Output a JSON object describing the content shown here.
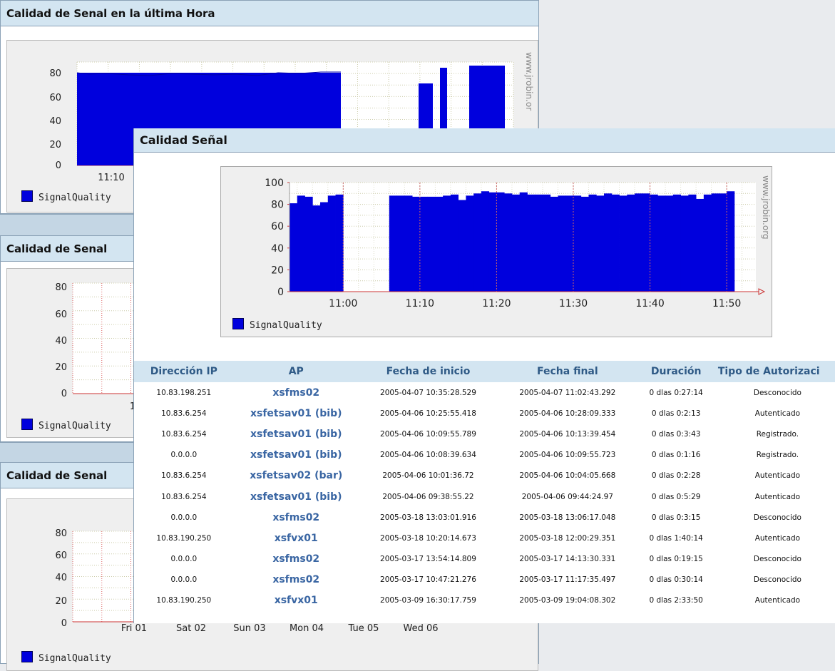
{
  "background_panels": {
    "hour": {
      "title": "Calidad de Senal en la última Hora",
      "y_ticks": [
        "80",
        "60",
        "40",
        "20",
        "0"
      ],
      "x_label": "11:10",
      "watermark": "www.jrobin.or",
      "legend": "SignalQuality"
    },
    "second": {
      "title": "Calidad de Senal",
      "y_ticks": [
        "80",
        "60",
        "40",
        "20",
        "0"
      ],
      "x_label_partial": "1",
      "legend": "SignalQuality"
    },
    "third": {
      "title": "Calidad de Senal",
      "y_ticks": [
        "80",
        "60",
        "40",
        "20",
        "0"
      ],
      "x_labels": [
        "Fri 01",
        "Sat 02",
        "Sun 03",
        "Mon 04",
        "Tue 05",
        "Wed 06"
      ],
      "legend": "SignalQuality"
    }
  },
  "front_window": {
    "title": "Calidad Señal",
    "legend": "SignalQuality",
    "watermark": "www.jrobin.org"
  },
  "chart_data": [
    {
      "type": "area",
      "title": "",
      "x": [
        "11:00",
        "11:10",
        "11:20",
        "11:30",
        "11:40",
        "11:50"
      ],
      "ylim": [
        0,
        100
      ],
      "y_ticks": [
        0,
        20,
        40,
        60,
        80,
        100
      ],
      "grid": true,
      "legend_position": "bottom-left",
      "series": [
        {
          "name": "SignalQuality",
          "color": "#0000dd",
          "points": [
            [
              "10:54",
              81
            ],
            [
              "10:55",
              88
            ],
            [
              "10:56",
              87
            ],
            [
              "10:57",
              79
            ],
            [
              "10:58",
              82
            ],
            [
              "10:59",
              88
            ],
            [
              "11:00",
              89
            ],
            [
              "11:07",
              88
            ],
            [
              "11:08",
              88
            ],
            [
              "11:09",
              88
            ],
            [
              "11:10",
              87
            ],
            [
              "11:11",
              87
            ],
            [
              "11:12",
              87
            ],
            [
              "11:13",
              87
            ],
            [
              "11:14",
              88
            ],
            [
              "11:15",
              89
            ],
            [
              "11:16",
              84
            ],
            [
              "11:17",
              88
            ],
            [
              "11:18",
              90
            ],
            [
              "11:19",
              92
            ],
            [
              "11:20",
              91
            ],
            [
              "11:21",
              91
            ],
            [
              "11:22",
              90
            ],
            [
              "11:23",
              89
            ],
            [
              "11:24",
              91
            ],
            [
              "11:25",
              89
            ],
            [
              "11:26",
              89
            ],
            [
              "11:27",
              89
            ],
            [
              "11:28",
              87
            ],
            [
              "11:29",
              88
            ],
            [
              "11:30",
              88
            ],
            [
              "11:31",
              88
            ],
            [
              "11:32",
              87
            ],
            [
              "11:33",
              89
            ],
            [
              "11:34",
              88
            ],
            [
              "11:35",
              90
            ],
            [
              "11:36",
              89
            ],
            [
              "11:37",
              88
            ],
            [
              "11:38",
              89
            ],
            [
              "11:39",
              90
            ],
            [
              "11:40",
              90
            ],
            [
              "11:41",
              89
            ],
            [
              "11:42",
              88
            ],
            [
              "11:43",
              88
            ],
            [
              "11:44",
              89
            ],
            [
              "11:45",
              88
            ],
            [
              "11:46",
              89
            ],
            [
              "11:47",
              85
            ],
            [
              "11:48",
              89
            ],
            [
              "11:49",
              90
            ],
            [
              "11:50",
              90
            ],
            [
              "11:51",
              92
            ]
          ]
        }
      ]
    }
  ],
  "table": {
    "headers": [
      "Dirección IP",
      "AP",
      "Fecha de inicio",
      "Fecha final",
      "Duración",
      "Tipo de Autorizaci"
    ],
    "rows": [
      [
        "10.83.198.251",
        "xsfms02",
        "2005-04-07 10:35:28.529",
        "2005-04-07 11:02:43.292",
        "0 dlas 0:27:14",
        "Desconocido"
      ],
      [
        "10.83.6.254",
        "xsfetsav01 (bib)",
        "2005-04-06 10:25:55.418",
        "2005-04-06 10:28:09.333",
        "0 dlas 0:2:13",
        "Autenticado"
      ],
      [
        "10.83.6.254",
        "xsfetsav01 (bib)",
        "2005-04-06 10:09:55.789",
        "2005-04-06 10:13:39.454",
        "0 dlas 0:3:43",
        "Registrado."
      ],
      [
        "0.0.0.0",
        "xsfetsav01 (bib)",
        "2005-04-06 10:08:39.634",
        "2005-04-06 10:09:55.723",
        "0 dlas 0:1:16",
        "Registrado."
      ],
      [
        "10.83.6.254",
        "xsfetsav02 (bar)",
        "2005-04-06 10:01:36.72",
        "2005-04-06 10:04:05.668",
        "0 dlas 0:2:28",
        "Autenticado"
      ],
      [
        "10.83.6.254",
        "xsfetsav01 (bib)",
        "2005-04-06 09:38:55.22",
        "2005-04-06 09:44:24.97",
        "0 dlas 0:5:29",
        "Autenticado"
      ],
      [
        "0.0.0.0",
        "xsfms02",
        "2005-03-18 13:03:01.916",
        "2005-03-18 13:06:17.048",
        "0 dlas 0:3:15",
        "Desconocido"
      ],
      [
        "10.83.190.250",
        "xsfvx01",
        "2005-03-18 10:20:14.673",
        "2005-03-18 12:00:29.351",
        "0 dlas 1:40:14",
        "Autenticado"
      ],
      [
        "0.0.0.0",
        "xsfms02",
        "2005-03-17 13:54:14.809",
        "2005-03-17 14:13:30.331",
        "0 dlas 0:19:15",
        "Desconocido"
      ],
      [
        "0.0.0.0",
        "xsfms02",
        "2005-03-17 10:47:21.276",
        "2005-03-17 11:17:35.497",
        "0 dlas 0:30:14",
        "Desconocido"
      ],
      [
        "10.83.190.250",
        "xsfvx01",
        "2005-03-09 16:30:17.759",
        "2005-03-09 19:04:08.302",
        "0 dlas 2:33:50",
        "Autenticado"
      ]
    ]
  }
}
